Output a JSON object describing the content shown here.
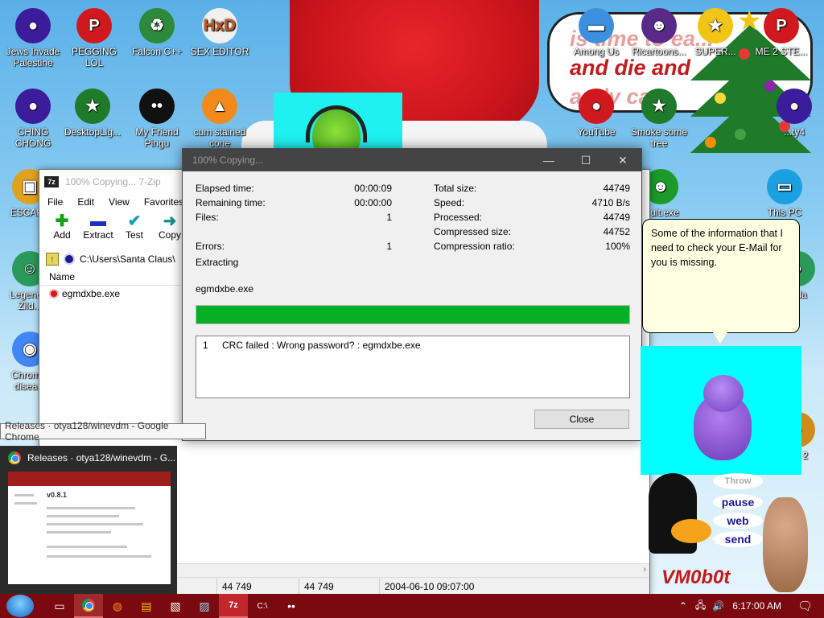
{
  "desktop": {
    "bubble_lines": [
      "is time to ea...",
      "and die and",
      "andy ca..."
    ],
    "icons": [
      {
        "label": "Jews Invade Palestine",
        "glyph": "●",
        "color": "#3b1c9b"
      },
      {
        "label": "PEGGING LOL",
        "glyph": "P",
        "color": "#d0191e"
      },
      {
        "label": "Falcon C++",
        "glyph": "♻",
        "color": "#2c8a3a"
      },
      {
        "label": "SEX EDITOR",
        "glyph": "HxD",
        "color": "#f0f0f0"
      },
      {
        "label": "CHING CHONG",
        "glyph": "●",
        "color": "#3b1c9b"
      },
      {
        "label": "DesktopLig...",
        "glyph": "★",
        "color": "#1f7a2a"
      },
      {
        "label": "My Friend Pingu",
        "glyph": "••",
        "color": "#111111"
      },
      {
        "label": "cum stained cone",
        "glyph": "▲",
        "color": "#f28a1b"
      },
      {
        "label": "ESCAPE",
        "glyph": "▣",
        "color": "#e0a020"
      },
      {
        "label": "Legend... Zild...",
        "glyph": "☺",
        "color": "#2a9a5a"
      },
      {
        "label": "Chrom... disea...",
        "glyph": "◉",
        "color": "#4285f4"
      },
      {
        "label": "Among Us",
        "glyph": "▬",
        "color": "#3d8fe0"
      },
      {
        "label": "Ricartoons...",
        "glyph": "☻",
        "color": "#5a2a8a"
      },
      {
        "label": "SUPER...",
        "glyph": "★",
        "color": "#f2c514"
      },
      {
        "label": "ME 2 STE...",
        "glyph": "P",
        "color": "#d0191e"
      },
      {
        "label": "YouTube",
        "glyph": "●",
        "color": "#d0191e"
      },
      {
        "label": "Smoke some tree",
        "glyph": "★",
        "color": "#1f7a2a"
      },
      {
        "label": "...ty4",
        "glyph": "●",
        "color": "#3b1c9b"
      },
      {
        "label": "...ult.exe",
        "glyph": "☻",
        "color": "#1b9b2a"
      },
      {
        "label": "This PC",
        "glyph": "▭",
        "color": "#1aa0e0"
      },
      {
        "label": "...da",
        "glyph": "●",
        "color": "#2a9a5a"
      },
      {
        "label": "...s 2",
        "glyph": "●",
        "color": "#d08a1a"
      }
    ]
  },
  "zip_window": {
    "title": "100% Copying... 7-Zip",
    "logo": "7z",
    "menu": [
      "File",
      "Edit",
      "View",
      "Favorites"
    ],
    "toolbar": [
      {
        "label": "Add",
        "glyph": "✚",
        "color": "#15a015"
      },
      {
        "label": "Extract",
        "glyph": "▬",
        "color": "#1b2fc0"
      },
      {
        "label": "Test",
        "glyph": "✔",
        "color": "#17a0b0"
      },
      {
        "label": "Copy",
        "glyph": "➜",
        "color": "#178f8f"
      }
    ],
    "path": "C:\\Users\\Santa Claus\\",
    "column_name": "Name",
    "file": "egmdxbe.exe",
    "status": [
      "44 749",
      "44 749",
      "2004-06-10 09:07:00"
    ]
  },
  "copy_dialog": {
    "title": "100% Copying...",
    "left_stats": [
      {
        "label": "Elapsed time:",
        "value": "00:00:09"
      },
      {
        "label": "Remaining time:",
        "value": "00:00:00"
      },
      {
        "label": "Files:",
        "value": "1"
      },
      {
        "label": "",
        "value": ""
      },
      {
        "label": "Errors:",
        "value": "1"
      }
    ],
    "right_stats": [
      {
        "label": "Total size:",
        "value": "44749"
      },
      {
        "label": "Speed:",
        "value": "4710 B/s"
      },
      {
        "label": "Processed:",
        "value": "44749"
      },
      {
        "label": "Compressed size:",
        "value": "44752"
      },
      {
        "label": "Compression ratio:",
        "value": "100%"
      }
    ],
    "operation": "Extracting",
    "current_file": "egmdxbe.exe",
    "progress_percent": 100,
    "message": {
      "index": "1",
      "text": "CRC failed : Wrong password? : egmdxbe.exe"
    },
    "close_label": "Close"
  },
  "chrome": {
    "tooltip": "Releases · otya128/winevdm - Google Chrome",
    "preview_title": "Releases · otya128/winevdm - G...",
    "thumb_heading": "v0.8.1"
  },
  "bonzi": {
    "message": "Some of the information that I need to check your E-Mail for you is missing."
  },
  "vmobot": {
    "buttons": [
      "Throw",
      "pause",
      "web",
      "send"
    ],
    "title": "VM0b0t"
  },
  "taskbar": {
    "clock": "6:17:00 AM",
    "items": [
      "▭",
      "◉",
      "◍",
      "▤",
      "▧",
      "▨",
      "7z",
      "C:\\",
      "••"
    ]
  },
  "colors": {
    "taskbar": "#7b0a10",
    "progress": "#06b025",
    "bonzi_bg": "#00ffff"
  }
}
